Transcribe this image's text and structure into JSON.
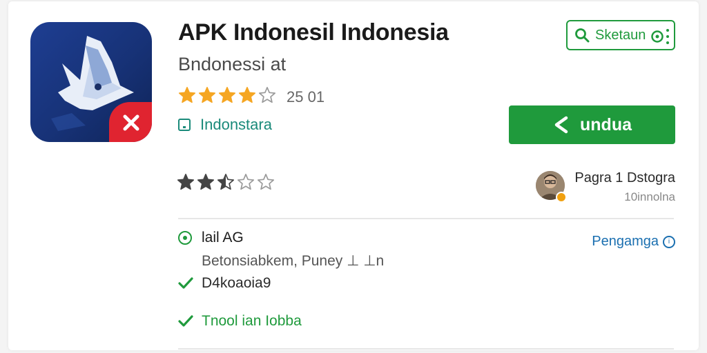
{
  "app": {
    "title": "APK Indonesil Indonesia",
    "subtitle": "Bndonessi at",
    "rating_count": "25 01",
    "rating_value": 4,
    "rating_max": 5,
    "developer": "Indonstara"
  },
  "actions": {
    "search_label": "Sketaun",
    "download_label": "undua"
  },
  "review": {
    "user_rating": 2.5,
    "reviewer_name": "Pagra 1 Dstogra",
    "reviewer_meta": "10innolna"
  },
  "info": {
    "title": "lail AG",
    "line": "Betonsiabkem, Puney ⊥ ⊥n",
    "more_link": "Pengamga",
    "checks": [
      {
        "label": "D4koaoia9",
        "green": false
      },
      {
        "label": "Tnool ian Iobba",
        "green": true
      }
    ]
  },
  "colors": {
    "accent_green": "#1f9a3c",
    "star_orange": "#f5a623",
    "badge_red": "#e02430",
    "link_blue": "#1a6fb0"
  },
  "icons": [
    "app-logo-icon",
    "close-badge-icon",
    "search-icon",
    "more-dots-icon",
    "share-icon",
    "star-icon",
    "developer-icon",
    "info-circle-icon",
    "check-icon"
  ]
}
